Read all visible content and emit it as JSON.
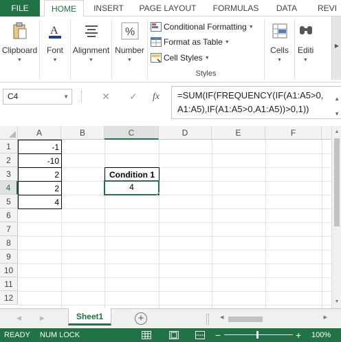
{
  "ribbon_tabs": [
    "FILE",
    "HOME",
    "INSERT",
    "PAGE LAYOUT",
    "FORMULAS",
    "DATA",
    "REVI"
  ],
  "groups": {
    "clipboard": "Clipboard",
    "font": "Font",
    "alignment": "Alignment",
    "number": "Number",
    "cells": "Cells",
    "editing": "Editi",
    "styles_title": "Styles"
  },
  "styles_items": [
    "Conditional Formatting",
    "Format as Table",
    "Cell Styles"
  ],
  "formula_bar": {
    "name_box": "C4",
    "cancel": "✕",
    "enter": "✓",
    "fx": "fx",
    "formula_line1": "=SUM(IF(FREQUENCY(IF(A1:A5>0,",
    "formula_line2": "A1:A5),IF(A1:A5>0,A1:A5))>0,1))"
  },
  "columns": [
    "A",
    "B",
    "C",
    "D",
    "E",
    "F"
  ],
  "rows": [
    "1",
    "2",
    "3",
    "4",
    "5",
    "6",
    "7",
    "8",
    "9",
    "10",
    "11",
    "12"
  ],
  "cells": {
    "A1": "-1",
    "A2": "-10",
    "A3": "2",
    "A4": "2",
    "A5": "4",
    "C3": "Condition 1",
    "C4": "4"
  },
  "sheet": {
    "name": "Sheet1",
    "add": "+"
  },
  "status": {
    "ready": "READY",
    "numlock": "NUM LOCK",
    "zoom": "100%",
    "minus": "−",
    "plus": "+"
  },
  "colors": {
    "accent": "#217346"
  }
}
